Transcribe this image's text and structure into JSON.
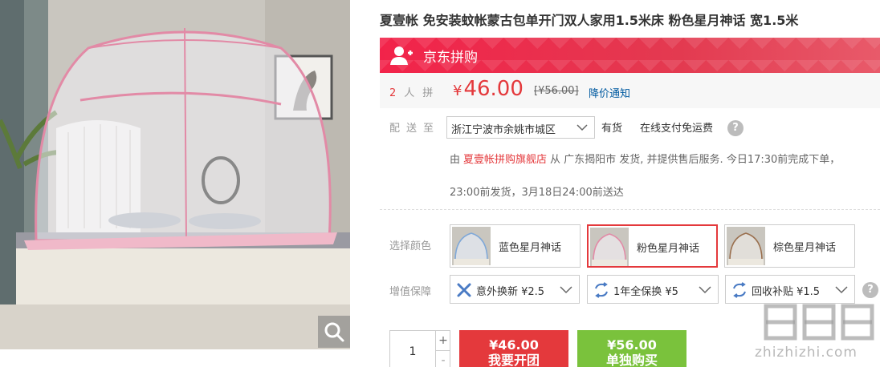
{
  "product": {
    "title": "夏壹帐 免安装蚊帐蒙古包单开门双人家用1.5米床 粉色星月神话 宽1.5米"
  },
  "pin": {
    "banner_label": "京东拼购",
    "group_size": "2",
    "group_suffix": "人拼",
    "price_currency": "¥",
    "price_value": "46.00",
    "original_price": "[¥56.00]",
    "notify_label": "降价通知"
  },
  "delivery": {
    "label": "配送至",
    "address": "浙江宁波市余姚市城区",
    "stock": "有货",
    "free_shipping": "在线支付免运费",
    "help": "?",
    "line1_prefix": "由",
    "shop_name": "夏壹帐拼购旗舰店",
    "line1_suffix": "从 广东揭阳市 发货, 并提供售后服务. 今日17:30前完成下单，",
    "line2": "23:00前发货，3月18日24:00前送达"
  },
  "colors": {
    "label": "选择颜色",
    "options": [
      {
        "name": "蓝色星月神话",
        "selected": false
      },
      {
        "name": "粉色星月神话",
        "selected": true
      },
      {
        "name": "棕色星月神话",
        "selected": false
      }
    ]
  },
  "services": {
    "label": "增值保障",
    "options": [
      {
        "name": "意外换新 ¥2.5",
        "icon": "tools-icon"
      },
      {
        "name": "1年全保换  ¥5",
        "icon": "exchange-icon"
      },
      {
        "name": "回收补贴 ¥1.5",
        "icon": "exchange-icon"
      }
    ],
    "help": "?"
  },
  "purchase": {
    "quantity": "1",
    "plus": "+",
    "minus": "-",
    "group_price": "¥46.00",
    "group_label": "我要开团",
    "single_price": "¥56.00",
    "single_label": "单独购买"
  },
  "watermark": {
    "site": "zhizhizhi.com"
  },
  "colors_theme": {
    "accent": "#e4393c",
    "banner": "#e7314b",
    "link": "#005aa0",
    "green": "#7ac23c"
  }
}
